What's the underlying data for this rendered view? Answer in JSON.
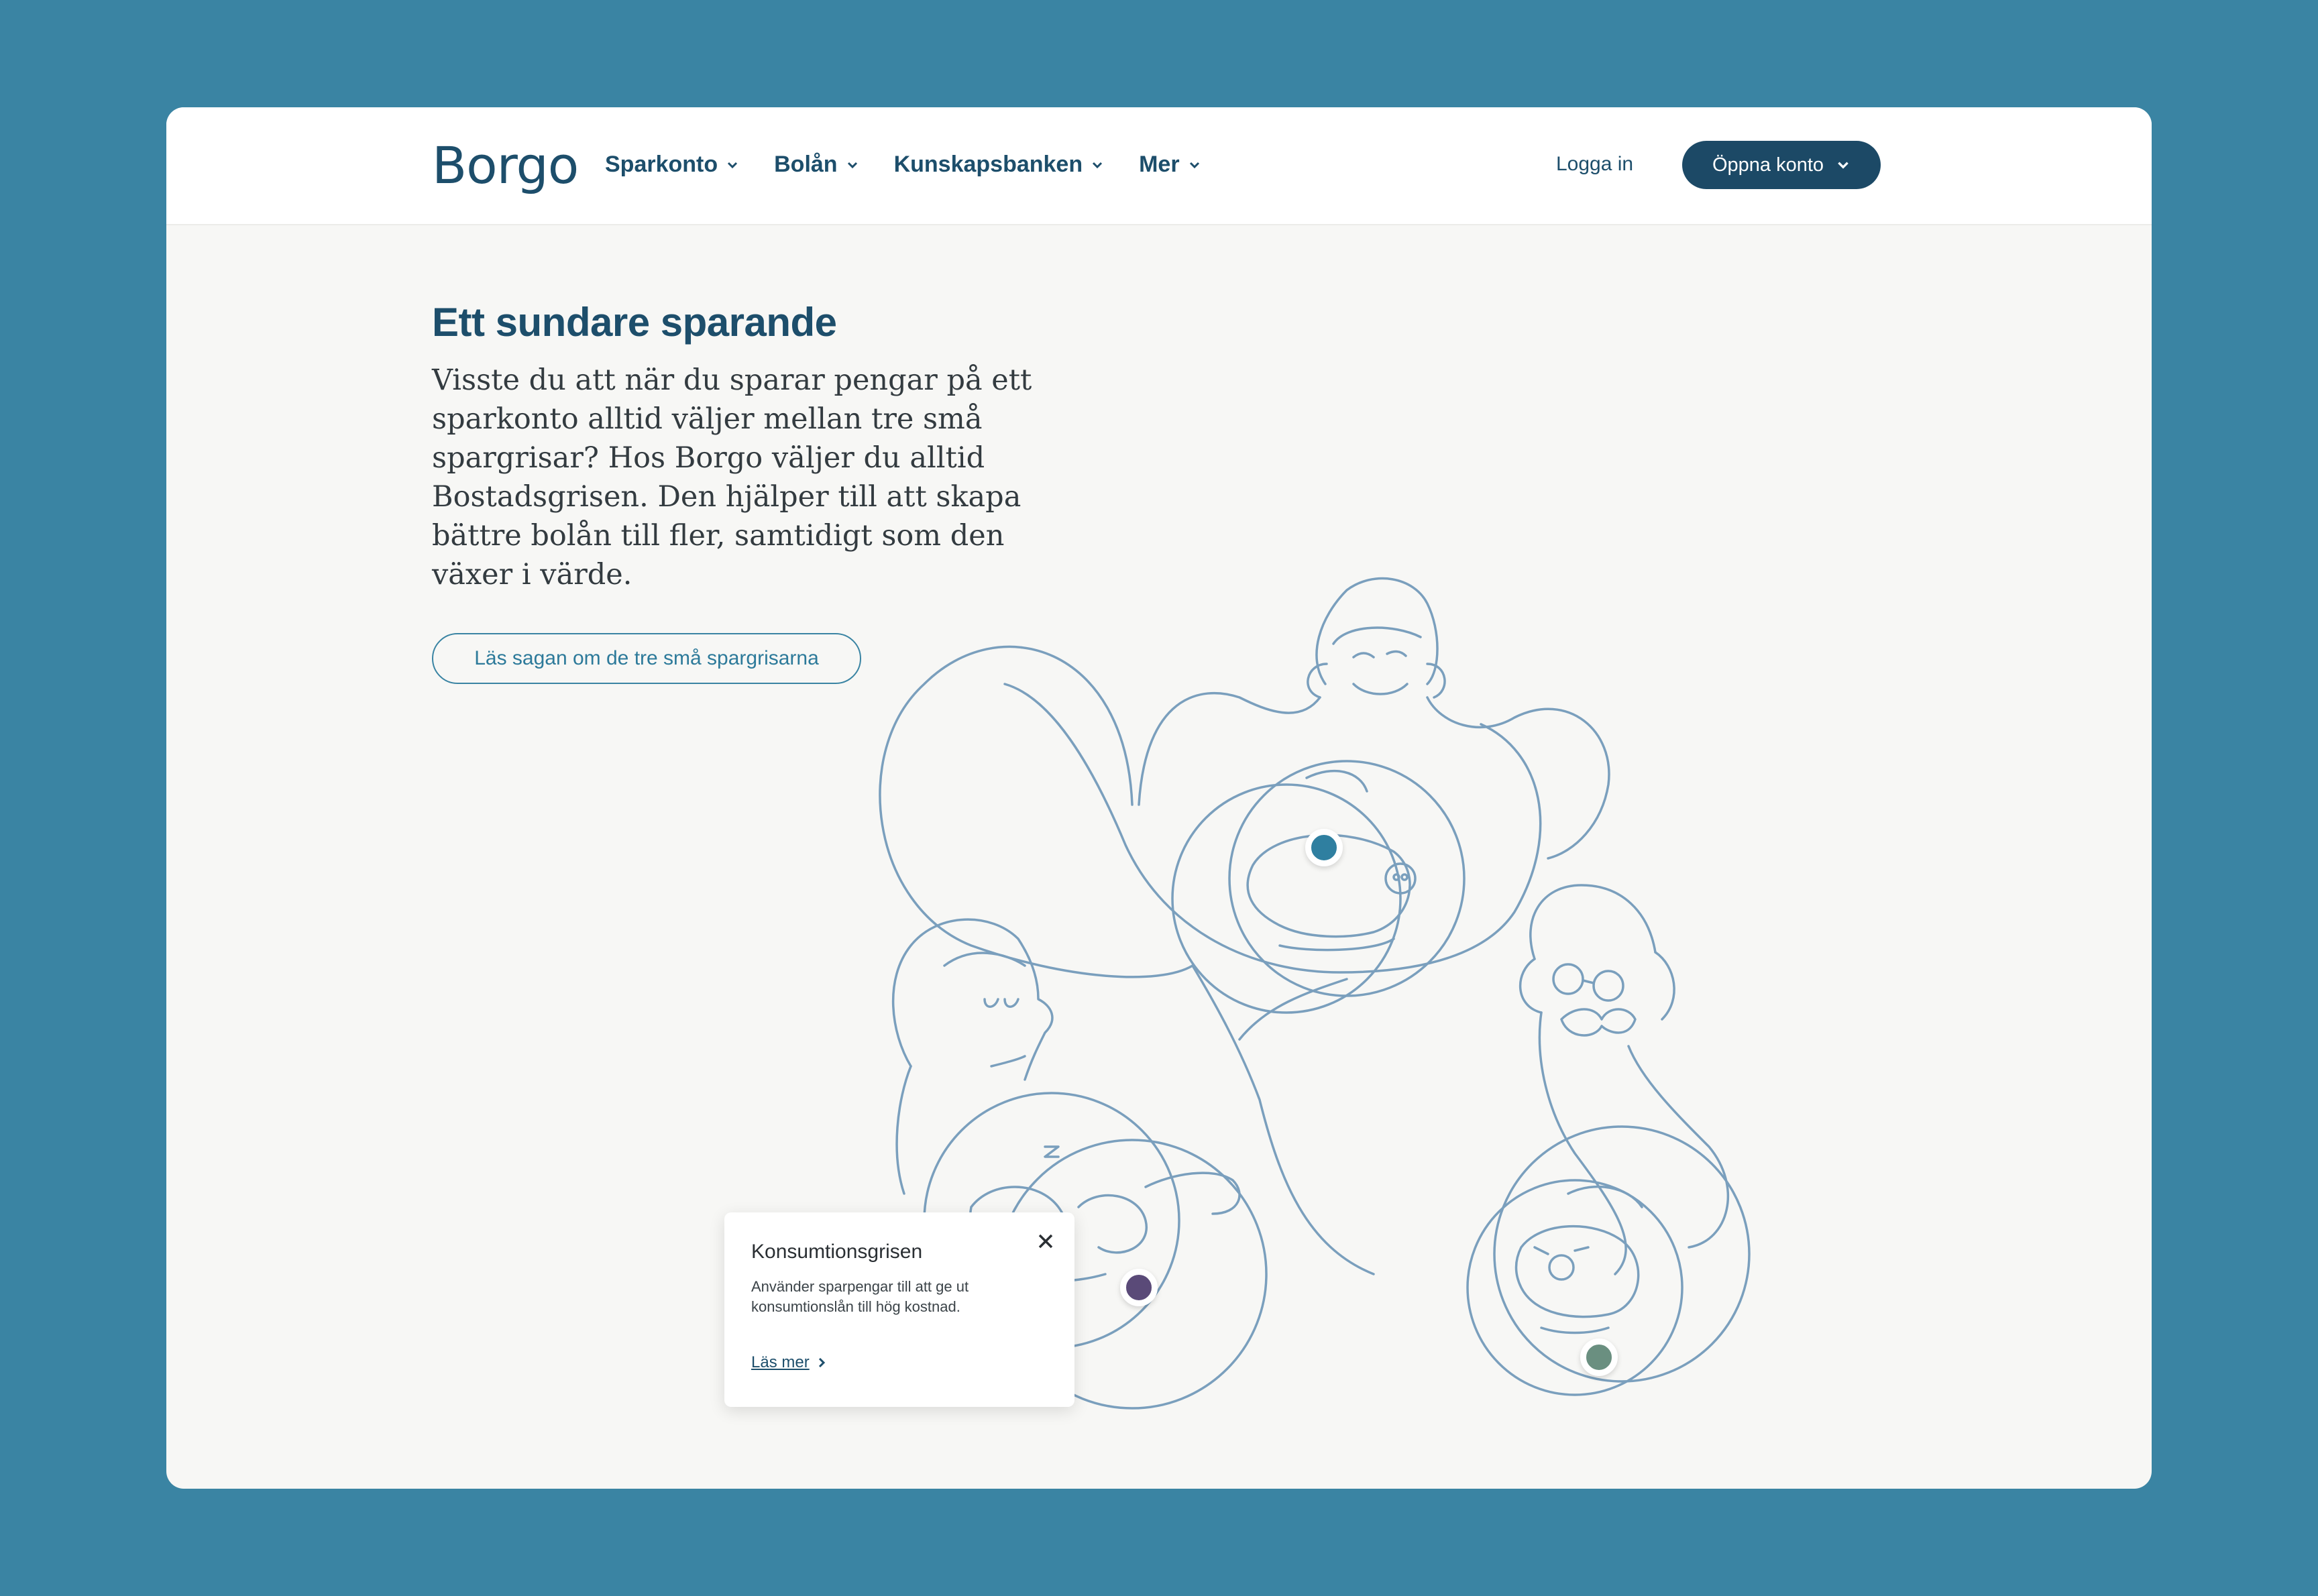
{
  "header": {
    "logo": "Borgo",
    "nav": [
      {
        "label": "Sparkonto"
      },
      {
        "label": "Bolån"
      },
      {
        "label": "Kunskapsbanken"
      },
      {
        "label": "Mer"
      }
    ],
    "login_label": "Logga in",
    "cta_label": "Öppna konto"
  },
  "hero": {
    "title": "Ett sundare sparande",
    "text": "Visste du att när du sparar pengar på ett sparkonto alltid väljer mellan tre små spargrisar? Hos Borgo väljer du alltid Bostadsgrisen. Den hjälper till att skapa bättre bolån till fler, samtidigt som den växer i värde.",
    "story_button": "Läs sagan om de tre små spargrisarna"
  },
  "tooltip": {
    "title": "Konsumtionsgrisen",
    "text": "Använder sparpengar till att ge ut konsumtionslån till hög kostnad.",
    "link": "Läs mer"
  },
  "hotspots": [
    {
      "name": "bostadsgrisen",
      "color": "#2f7fa0"
    },
    {
      "name": "konsumtionsgrisen",
      "color": "#5a4a78"
    },
    {
      "name": "tredje-grisen",
      "color": "#6a8f80"
    }
  ],
  "icons": [
    "chevron-down-icon",
    "close-icon",
    "chevron-right-icon"
  ],
  "colors": {
    "background": "#3a84a3",
    "brand": "#1d4e6b",
    "illustration": "#7a9fbd"
  }
}
